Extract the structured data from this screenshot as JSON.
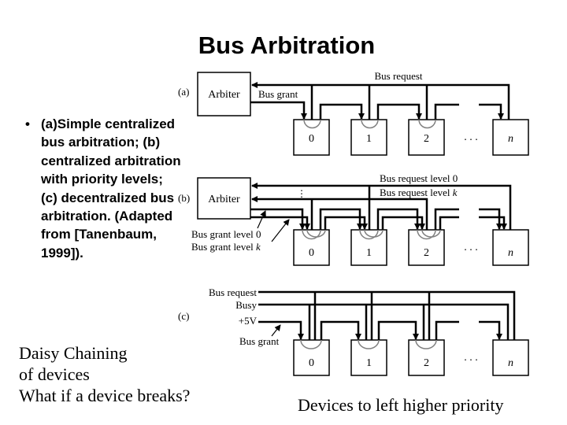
{
  "slide": {
    "title": "Bus Arbitration",
    "bullet": "(a)Simple centralized bus arbitration; (b) centralized arbitration with priority levels; (c) decentralized bus arbitration. (Adapted from [Tanenbaum, 1999]).",
    "bullet_symbol": "•",
    "notes_left": [
      "Daisy Chaining",
      "of devices",
      "What if a device breaks?"
    ],
    "note_right": "Devices to left higher priority"
  },
  "diagram": {
    "devices": [
      "0",
      "1",
      "2",
      "n"
    ],
    "ellipsis": ". . .",
    "panel_a": {
      "tag": "(a)",
      "arbiter": "Arbiter",
      "bus_request": "Bus request",
      "bus_grant": "Bus grant"
    },
    "panel_b": {
      "tag": "(b)",
      "arbiter": "Arbiter",
      "vertical_ellipsis": "⋮",
      "request_level_0": "Bus request level 0",
      "request_level_k_prefix": "Bus request level ",
      "level_k": "k",
      "grant_level_0": "Bus grant level 0",
      "grant_level_k_prefix": "Bus grant level "
    },
    "panel_c": {
      "tag": "(c)",
      "bus_request": "Bus request",
      "busy": "Busy",
      "plus5v": "+5V",
      "bus_grant": "Bus grant"
    },
    "colors": {
      "line": "#000000",
      "arc": "#808080",
      "background": "#ffffff"
    }
  }
}
